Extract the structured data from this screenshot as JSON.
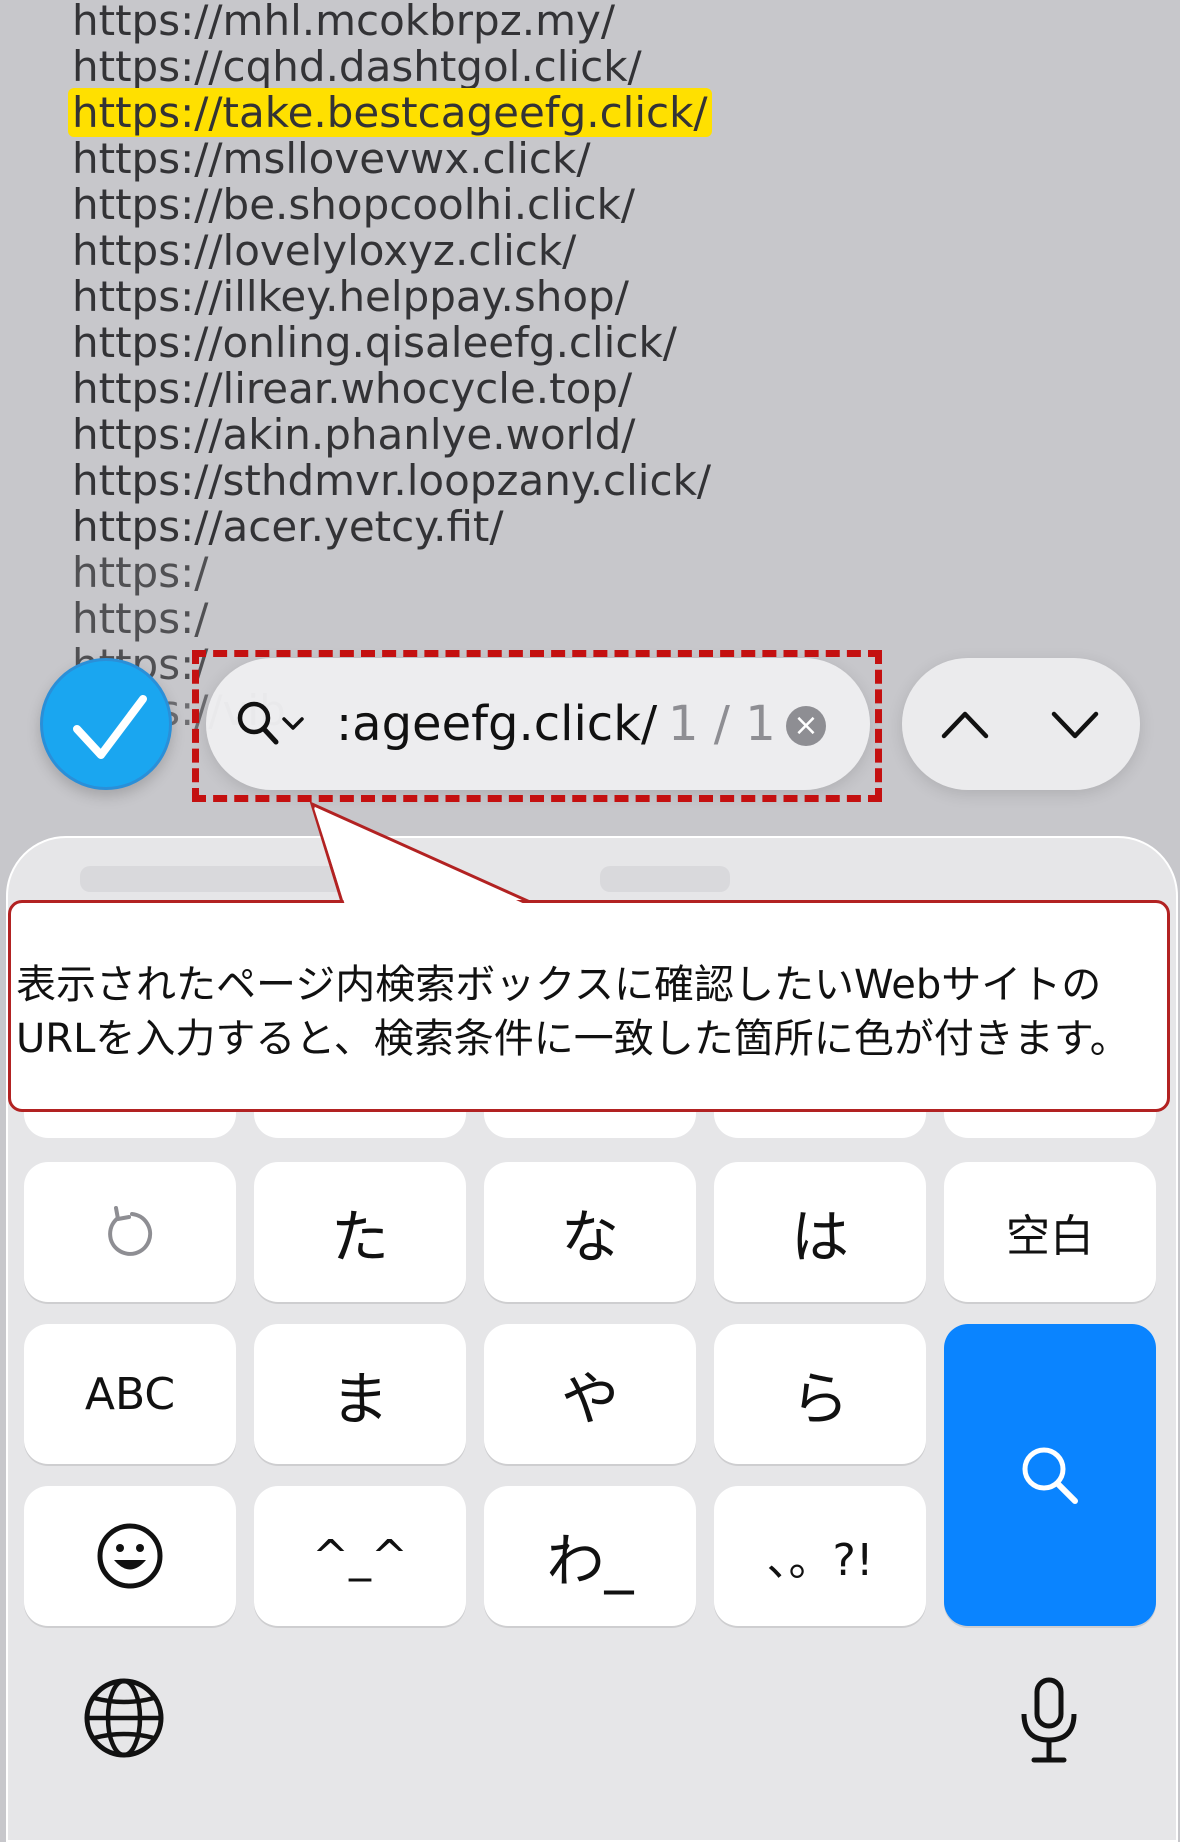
{
  "page": {
    "urls": [
      "https://mhl.mcokbrpz.my/",
      "https://cqhd.dashtgol.click/",
      "https://take.bestcageefg.click/",
      "https://msllovevwx.click/",
      "https://be.shopcoolhi.click/",
      "https://lovelyloxyz.click/",
      "https://illkey.helppay.shop/",
      "https://onling.qisaleefg.click/",
      "https://lirear.whocycle.top/",
      "https://akin.phanlye.world/",
      "https://sthdmvr.loopzany.click/",
      "https://acer.yetcy.fit/"
    ],
    "partial_urls": [
      "https:/",
      "https:/",
      "https:/",
      "https://vib"
    ],
    "highlighted_index": 2
  },
  "find_bar": {
    "query": ":ageefg.click/",
    "match_count": "1 / 1",
    "done_icon": "checkmark-icon",
    "search_icon": "search-icon"
  },
  "callout": {
    "line1": "表示されたページ内検索ボックスに確認したいWebサイトの",
    "line2": "URLを入力すると、検索条件に一致した箇所に色が付きます。"
  },
  "keyboard": {
    "row2": [
      "た",
      "な",
      "は",
      "空白"
    ],
    "row3": [
      "ABC",
      "ま",
      "や",
      "ら"
    ],
    "row4": [
      "^_^",
      "わ_",
      "、。?!"
    ],
    "undo_icon": "undo-icon",
    "emoji_icon": "emoji-icon",
    "search_key_icon": "search-icon",
    "globe_icon": "globe-icon",
    "mic_icon": "microphone-icon",
    "accent_color": "#0a84ff"
  },
  "colors": {
    "highlight": "#ffe000",
    "annotation_red": "#c41010"
  }
}
